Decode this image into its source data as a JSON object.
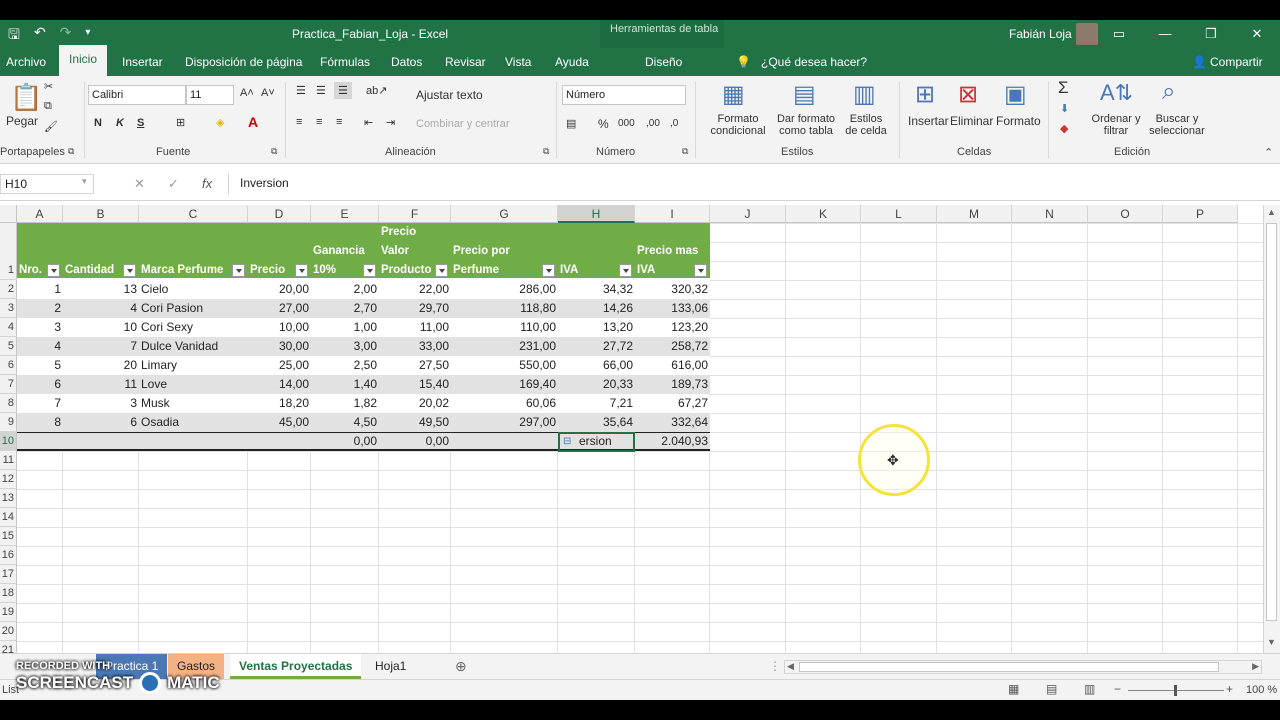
{
  "titlebar": {
    "title": "Practica_Fabian_Loja  -  Excel",
    "context_tools": "Herramientas de tabla",
    "user": "Fabián Loja"
  },
  "tabs": [
    "Archivo",
    "Inicio",
    "Insertar",
    "Disposición de página",
    "Fórmulas",
    "Datos",
    "Revisar",
    "Vista",
    "Ayuda",
    "Diseño"
  ],
  "tell_me": "¿Qué desea hacer?",
  "share": "Compartir",
  "ribbon": {
    "paste": "Pegar",
    "font_name": "Calibri",
    "font_size": "11",
    "bold": "N",
    "italic": "K",
    "underline": "S",
    "wrap_text": "Ajustar texto",
    "merge_center": "Combinar y centrar",
    "number_format": "Número",
    "cond_format": "Formato condicional",
    "format_table": "Dar formato como tabla",
    "cell_styles": "Estilos de celda",
    "insert": "Insertar",
    "delete": "Eliminar",
    "format": "Formato",
    "sort_filter": "Ordenar y filtrar",
    "find_select": "Buscar y seleccionar",
    "groups": [
      "Portapapeles",
      "Fuente",
      "Alineación",
      "Número",
      "Estilos",
      "Celdas",
      "Edición"
    ]
  },
  "formula_bar": {
    "name_box": "H10",
    "content": "Inversion"
  },
  "columns": [
    "A",
    "B",
    "C",
    "D",
    "E",
    "F",
    "G",
    "H",
    "I",
    "J",
    "K",
    "L",
    "M",
    "N",
    "O",
    "P"
  ],
  "rows": [
    "1",
    "2",
    "3",
    "4",
    "5",
    "6",
    "7",
    "8",
    "9",
    "10",
    "11",
    "12",
    "13",
    "14",
    "15",
    "16",
    "17",
    "18",
    "19",
    "20",
    "21"
  ],
  "table": {
    "headers": [
      [
        "Nro."
      ],
      [
        "Cantidad"
      ],
      [
        "Marca Perfume"
      ],
      [
        "Precio"
      ],
      [
        "Ganancia",
        "10%"
      ],
      [
        "Precio",
        "Valor",
        "Producto"
      ],
      [
        "Precio por",
        "Perfume"
      ],
      [
        "IVA"
      ],
      [
        "Precio mas",
        "IVA"
      ]
    ],
    "rows": [
      [
        "1",
        "13",
        "Cielo",
        "20,00",
        "2,00",
        "22,00",
        "286,00",
        "34,32",
        "320,32"
      ],
      [
        "2",
        "4",
        "Cori Pasion",
        "27,00",
        "2,70",
        "29,70",
        "118,80",
        "14,26",
        "133,06"
      ],
      [
        "3",
        "10",
        "Cori Sexy",
        "10,00",
        "1,00",
        "11,00",
        "110,00",
        "13,20",
        "123,20"
      ],
      [
        "4",
        "7",
        "Dulce Vanidad",
        "30,00",
        "3,00",
        "33,00",
        "231,00",
        "27,72",
        "258,72"
      ],
      [
        "5",
        "20",
        "Limary",
        "25,00",
        "2,50",
        "27,50",
        "550,00",
        "66,00",
        "616,00"
      ],
      [
        "6",
        "11",
        "Love",
        "14,00",
        "1,40",
        "15,40",
        "169,40",
        "20,33",
        "189,73"
      ],
      [
        "7",
        "3",
        "Musk",
        "18,20",
        "1,82",
        "20,02",
        "60,06",
        "7,21",
        "67,27"
      ],
      [
        "8",
        "6",
        "Osadia",
        "45,00",
        "4,50",
        "49,50",
        "297,00",
        "35,64",
        "332,64"
      ]
    ],
    "totals": [
      "",
      "",
      "",
      "",
      "0,00",
      "0,00",
      "",
      "ersion",
      "2.040,93"
    ]
  },
  "sheets": [
    "Practica 1",
    "Gastos",
    "Ventas Proyectadas",
    "Hoja1"
  ],
  "status": {
    "left": "List",
    "zoom": "100 %"
  },
  "watermark": {
    "line1": "RECORDED WITH",
    "line2": "SCREENCAST",
    "line3": "MATIC"
  }
}
